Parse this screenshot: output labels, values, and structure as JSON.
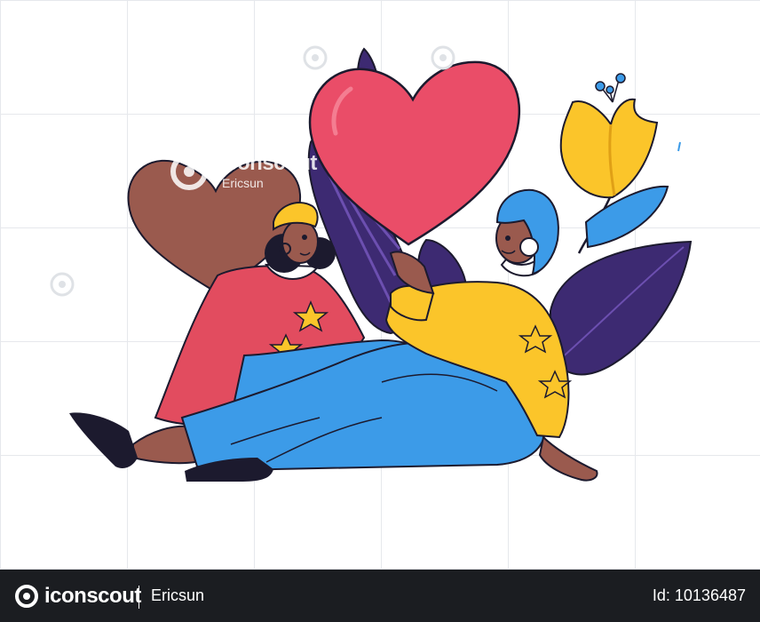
{
  "watermark": {
    "brand": "iconscout",
    "author": "Ericsun"
  },
  "footer": {
    "brand": "iconscout",
    "author": "Ericsun",
    "asset_id": "Id: 10136487"
  },
  "colors": {
    "heart_red": "#ea4d68",
    "heart_brown": "#9a5a4e",
    "leaf_purple": "#3d2a72",
    "flower_yellow": "#fbc52a",
    "denim_blue": "#3c9be8",
    "sweater_pink": "#e24c5f",
    "outline": "#1c1a2e",
    "footer_bg": "#1b1d21"
  },
  "icons": [
    "iconscout-logo-icon"
  ]
}
